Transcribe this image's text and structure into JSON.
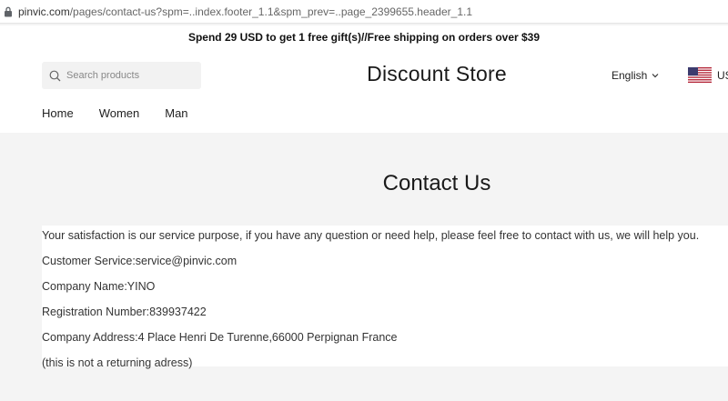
{
  "browser": {
    "url_domain": "pinvic.com",
    "url_path": "/pages/contact-us?spm=..index.footer_1.1&spm_prev=..page_2399655.header_1.1"
  },
  "announcement": "Spend 29 USD to get 1 free gift(s)//Free shipping on orders over $39",
  "header": {
    "search_placeholder": "Search products",
    "store_name": "Discount Store",
    "language": "English",
    "currency": "US"
  },
  "nav": {
    "items": [
      {
        "label": "Home"
      },
      {
        "label": "Women"
      },
      {
        "label": "Man"
      }
    ]
  },
  "page": {
    "title": "Contact Us",
    "lines": [
      "Your satisfaction is our service purpose, if you have any question or need help, please feel free to contact with us, we will help you.",
      "Customer Service:service@pinvic.com",
      "Company Name:YINO",
      "Registration Number:839937422",
      "Company Address:4 Place Henri De Turenne,66000 Perpignan France",
      "(this is not a returning adress)"
    ]
  },
  "icons": {
    "lock": "lock-icon",
    "search": "search-icon",
    "chevron": "chevron-down-icon",
    "flag": "us-flag-icon"
  }
}
